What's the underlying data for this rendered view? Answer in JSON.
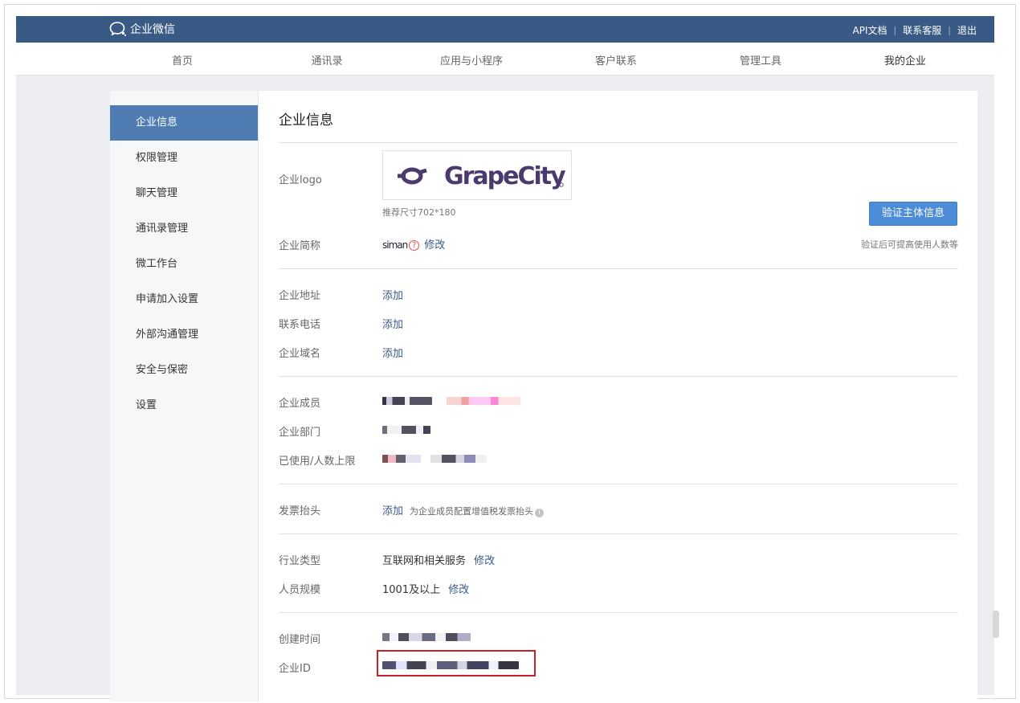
{
  "header": {
    "brand": "企业微信",
    "links": [
      "API文档",
      "联系客服",
      "退出"
    ]
  },
  "nav": {
    "items": [
      "首页",
      "通讯录",
      "应用与小程序",
      "客户联系",
      "管理工具",
      "我的企业"
    ],
    "active": "我的企业"
  },
  "sidebar": {
    "items": [
      "企业信息",
      "权限管理",
      "聊天管理",
      "通讯录管理",
      "微工作台",
      "申请加入设置",
      "外部沟通管理",
      "安全与保密",
      "设置"
    ]
  },
  "page": {
    "title": "企业信息",
    "logo": {
      "label": "企业logo",
      "text": "GrapeCity",
      "hint": "推荐尺寸702*180"
    },
    "verify": {
      "button": "验证主体信息",
      "hint": "验证后可提高使用人数等"
    },
    "short_name": {
      "label": "企业简称",
      "value": "siman",
      "edit": "修改"
    },
    "address": {
      "label": "企业地址",
      "action": "添加"
    },
    "phone": {
      "label": "联系电话",
      "action": "添加"
    },
    "domain": {
      "label": "企业域名",
      "action": "添加"
    },
    "members": {
      "label": "企业成员"
    },
    "departments": {
      "label": "企业部门"
    },
    "usage": {
      "label": "已使用/人数上限"
    },
    "invoice": {
      "label": "发票抬头",
      "action": "添加",
      "hint": "为企业成员配置增值税发票抬头",
      "info_icon": "info-icon"
    },
    "industry": {
      "label": "行业类型",
      "value": "互联网和相关服务",
      "edit": "修改"
    },
    "scale": {
      "label": "人员规模",
      "value": "1001及以上",
      "edit": "修改"
    },
    "created": {
      "label": "创建时间"
    },
    "corp_id": {
      "label": "企业ID"
    }
  },
  "colors": {
    "topbar": "#3a5a86",
    "accent": "#4f7cb2",
    "button": "#4d8cd6",
    "highlight": "#c8202a",
    "logo": "#4b3a6e"
  }
}
